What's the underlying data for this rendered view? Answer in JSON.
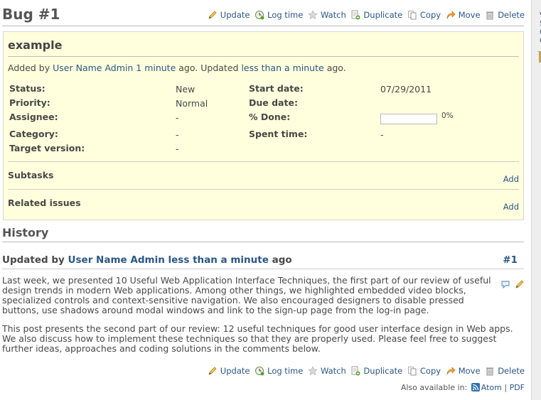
{
  "issue": {
    "title": "Bug #1",
    "subject": "example",
    "author_prefix": "Added by",
    "author": "User Name Admin",
    "created_ago": "1 minute",
    "updated_mid": "ago. Updated",
    "updated_ago": "less than a minute",
    "updated_suffix": "ago.",
    "attributes": {
      "status_label": "Status:",
      "status_value": "New",
      "priority_label": "Priority:",
      "priority_value": "Normal",
      "assignee_label": "Assignee:",
      "assignee_value": "-",
      "category_label": "Category:",
      "category_value": "-",
      "target_label": "Target version:",
      "target_value": "-",
      "start_label": "Start date:",
      "start_value": "07/29/2011",
      "due_label": "Due date:",
      "due_value": "",
      "done_label": "% Done:",
      "done_value": "0%",
      "done_fraction": 0,
      "spent_label": "Spent time:",
      "spent_value": "-"
    },
    "subtasks_title": "Subtasks",
    "related_title": "Related issues",
    "add_label": "Add"
  },
  "actions": {
    "update": "Update",
    "log_time": "Log time",
    "watch": "Watch",
    "duplicate": "Duplicate",
    "copy": "Copy",
    "move": "Move",
    "delete": "Delete"
  },
  "history": {
    "title": "History",
    "journal": {
      "prefix": "Updated by",
      "author": "User Name Admin",
      "ago": "less than a minute",
      "suffix": "ago",
      "number": "#1",
      "para1": "Last week, we presented 10 Useful Web Application Interface Techniques, the first part of our review of useful design trends in modern Web applications. Among other things, we highlighted embedded video blocks, specialized controls and context-sensitive navigation. We also encouraged designers to disable pressed buttons, use shadows around modal windows and link to the sign-up page from the log-in page.",
      "para2": "This post presents the second part of our review: 12 useful techniques for good user interface design in Web apps. We also discuss how to implement these techniques so that they are properly used. Please feel free to suggest further ideas, approaches and coding solutions in the comments below."
    }
  },
  "footer": {
    "also_available": "Also available in:",
    "atom": "Atom",
    "separator": "|",
    "pdf": "PDF"
  },
  "sidebar": {
    "letters": [
      "V",
      "S",
      "C",
      "C"
    ]
  },
  "colors": {
    "link": "#2a5685",
    "issue_bg": "#ffffdd",
    "text": "#484848"
  }
}
